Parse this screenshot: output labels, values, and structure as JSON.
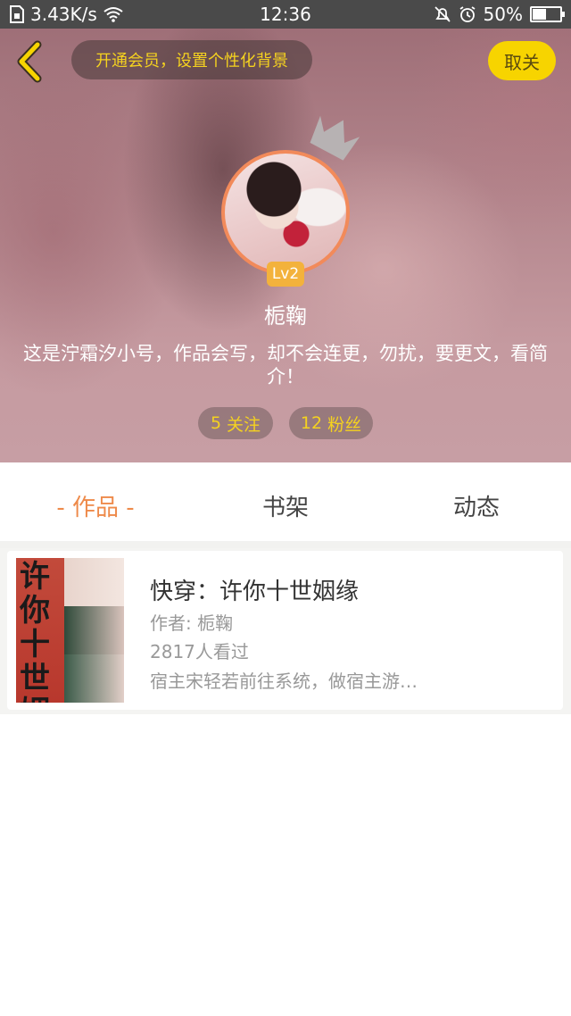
{
  "status_bar": {
    "network_speed": "3.43K/s",
    "time": "12:36",
    "battery": "50%",
    "battery_level": 0.5,
    "icons": [
      "sim-icon",
      "wifi-icon",
      "mute-icon",
      "alarm-icon",
      "battery-icon"
    ]
  },
  "header": {
    "back_icon": "back-chevron-icon",
    "promo_text": "开通会员，设置个性化背景",
    "follow_label": "取关",
    "level_badge": "Lv2",
    "username": "栀鞠",
    "bio": "这是泞霜汐小号，作品会写，却不会连更，勿扰，要更文，看简介！",
    "stats": {
      "following_count": "5",
      "following_label": "关注",
      "fans_count": "12",
      "fans_label": "粉丝"
    }
  },
  "tabs": [
    {
      "label": "- 作品 -",
      "active": true
    },
    {
      "label": "书架",
      "active": false
    },
    {
      "label": "动态",
      "active": false
    }
  ],
  "works": [
    {
      "title": "快穿：许你十世姻缘",
      "author": "作者: 栀鞠",
      "views": "2817人看过",
      "description": "宿主宋轻若前往系统，做宿主游…",
      "cover_text": "许你十世姻缘"
    }
  ],
  "colors": {
    "accent": "#ee8a4a",
    "yellow": "#f7d400",
    "promo_text": "#f5d21f",
    "level_badge": "#f3b23c"
  }
}
